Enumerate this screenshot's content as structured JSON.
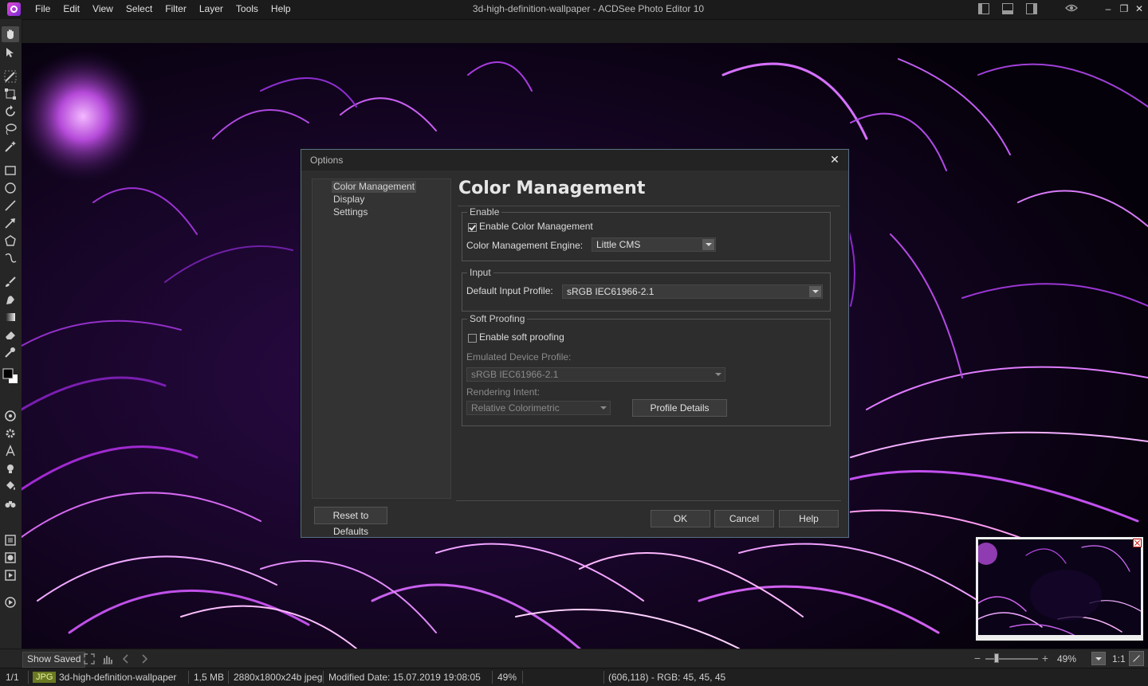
{
  "window": {
    "title": "3d-high-definition-wallpaper - ACDSee Photo Editor 10",
    "controls": {
      "minimize": "–",
      "restore": "❐",
      "close": "✕"
    }
  },
  "menubar": {
    "items": [
      "File",
      "Edit",
      "View",
      "Select",
      "Filter",
      "Layer",
      "Tools",
      "Help"
    ]
  },
  "toolbar": {
    "tools": [
      "hand-icon",
      "select-arrow-icon",
      "brush-select-icon",
      "transform-icon",
      "rotate-icon",
      "lasso-icon",
      "magic-wand-icon",
      "rectangle-icon",
      "ellipse-icon",
      "line-icon",
      "arrow-line-icon",
      "polygon-icon",
      "curve-icon",
      "paint-brush-icon",
      "smudge-icon",
      "gradient-icon",
      "eraser-icon",
      "eyedropper-icon"
    ]
  },
  "dialog": {
    "title": "Options",
    "close_label": "✕",
    "nav": [
      "Color Management",
      "Display",
      "Settings"
    ],
    "selected_nav": "Color Management",
    "heading": "Color Management",
    "enable_group": {
      "label": "Enable",
      "enable_cm_label": "Enable Color Management",
      "enable_cm_checked": true,
      "engine_label": "Color Management Engine:",
      "engine_value": "Little CMS"
    },
    "input_group": {
      "label": "Input",
      "default_profile_label": "Default Input Profile:",
      "default_profile_value": "sRGB IEC61966-2.1"
    },
    "soft_proofing_group": {
      "label": "Soft Proofing",
      "enable_soft_label": "Enable soft proofing",
      "enable_soft_checked": false,
      "emulated_label": "Emulated Device Profile:",
      "emulated_value": "sRGB IEC61966-2.1",
      "rendering_label": "Rendering Intent:",
      "rendering_value": "Relative Colorimetric",
      "profile_details_label": "Profile Details"
    },
    "reset_label": "Reset to Defaults",
    "ok_label": "OK",
    "cancel_label": "Cancel",
    "help_label": "Help"
  },
  "bottombar": {
    "show_saved_label": "Show Saved",
    "zoom_value": "49%",
    "zoom_one": "1:1",
    "zoom_minus": "−",
    "zoom_plus": "+"
  },
  "status": {
    "page": "1/1",
    "format": "JPG",
    "filename": "3d-high-definition-wallpaper",
    "filesize": "1,5 MB",
    "dimensions": "2880x1800x24b jpeg",
    "modified": "Modified Date: 15.07.2019 19:08:05",
    "zoom": "49%",
    "pixel_info": "(606,118) - RGB: 45, 45, 45"
  },
  "colors": {
    "accent_purple": "#b23ad9",
    "dialog_border": "#5a6c8a",
    "badge_green": "#6a7a22"
  }
}
